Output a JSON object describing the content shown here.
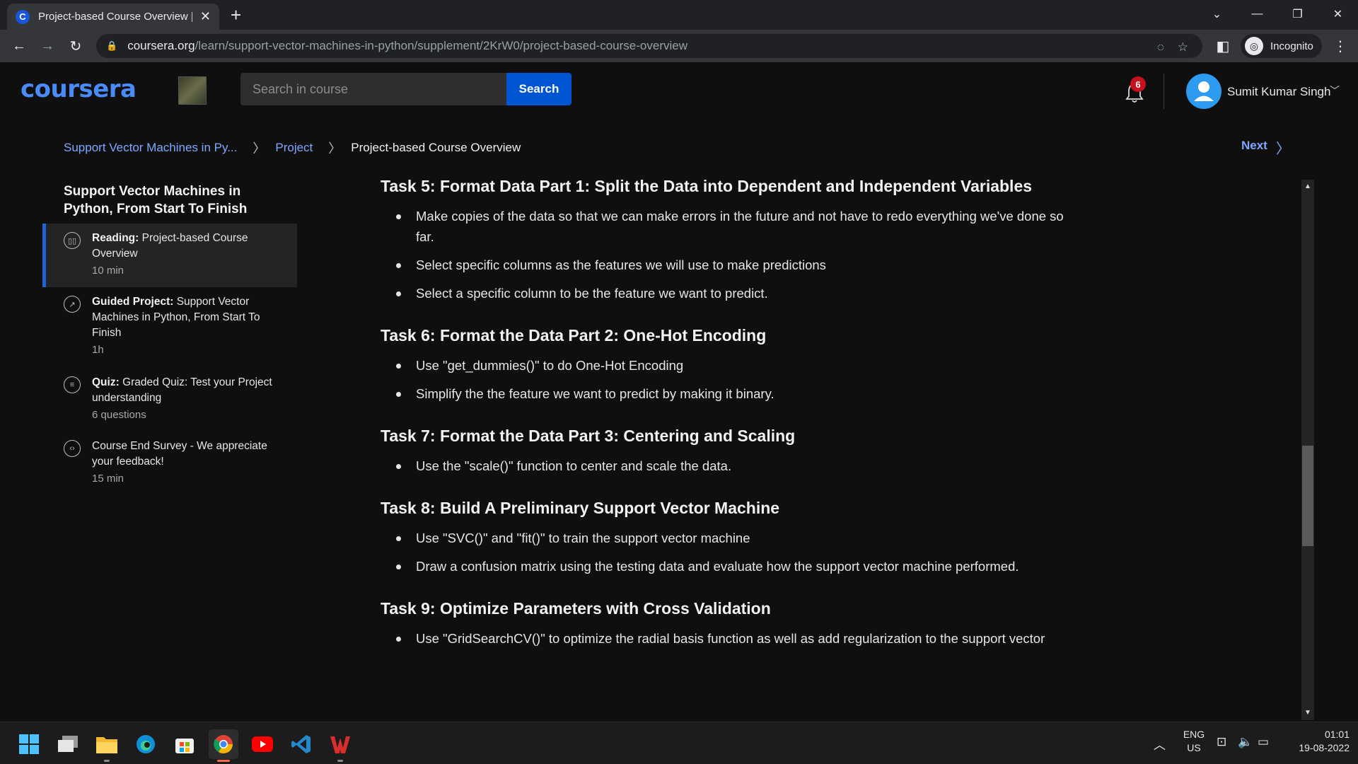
{
  "browser": {
    "tab_title": "Project-based Course Overview |",
    "tab_favicon_letter": "C",
    "url_host": "coursera.org",
    "url_path": "/learn/support-vector-machines-in-python/supplement/2KrW0/project-based-course-overview",
    "profile_label": "Incognito"
  },
  "header": {
    "logo": "coursera",
    "search_placeholder": "Search in course",
    "search_button": "Search",
    "notification_count": "6",
    "user_name": "Sumit Kumar Singh",
    "brand_color": "#0056d2"
  },
  "breadcrumb": {
    "items": [
      "Support Vector Machines in Py...",
      "Project"
    ],
    "current": "Project-based Course Overview",
    "next_label": "Next"
  },
  "sidebar": {
    "title": "Support Vector Machines in Python, From Start To Finish",
    "items": [
      {
        "icon": "reading-icon",
        "type": "Reading:",
        "label": "Project-based Course Overview",
        "meta": "10 min",
        "active": true
      },
      {
        "icon": "guided-project-icon",
        "type": "Guided Project:",
        "label": "Support Vector Machines in Python, From Start To Finish",
        "meta": "1h",
        "active": false
      },
      {
        "icon": "quiz-icon",
        "type": "Quiz:",
        "label": "Graded Quiz: Test your Project understanding",
        "meta": "6 questions",
        "active": false
      },
      {
        "icon": "survey-icon",
        "type": "",
        "label": "Course End Survey - We appreciate your feedback!",
        "meta": "15 min",
        "active": false
      }
    ]
  },
  "content": {
    "tasks": [
      {
        "heading": "Task 5: Format Data Part 1: Split the Data into Dependent and Independent Variables",
        "bullets": [
          "Make copies of the data so that we can make errors in the future and not have to redo everything we've done so far.",
          "Select specific columns as the features we will use to make predictions",
          "Select a specific column to be the feature we want to predict."
        ]
      },
      {
        "heading": "Task 6: Format the Data Part 2: One-Hot Encoding",
        "bullets": [
          "Use \"get_dummies()\" to do One-Hot Encoding",
          "Simplify the the feature we want to predict by making it binary."
        ]
      },
      {
        "heading": "Task 7: Format the Data Part 3: Centering and Scaling",
        "bullets": [
          "Use the \"scale()\" function to center and scale the data."
        ]
      },
      {
        "heading": "Task 8: Build A Preliminary Support Vector Machine",
        "bullets": [
          "Use \"SVC()\" and \"fit()\" to train the support vector machine",
          "Draw a confusion matrix using the testing data and evaluate how the support vector machine performed."
        ]
      },
      {
        "heading": "Task 9: Optimize Parameters with Cross Validation",
        "bullets": [
          "Use \"GridSearchCV()\" to optimize the radial basis function as well as add regularization to the support vector"
        ]
      }
    ]
  },
  "taskbar": {
    "apps": [
      "start-icon",
      "task-view-icon",
      "file-explorer-icon",
      "edge-icon",
      "store-icon",
      "chrome-icon",
      "youtube-icon",
      "vscode-icon",
      "wps-icon"
    ],
    "lang_top": "ENG",
    "lang_bottom": "US",
    "time": "01:01",
    "date": "19-08-2022"
  }
}
